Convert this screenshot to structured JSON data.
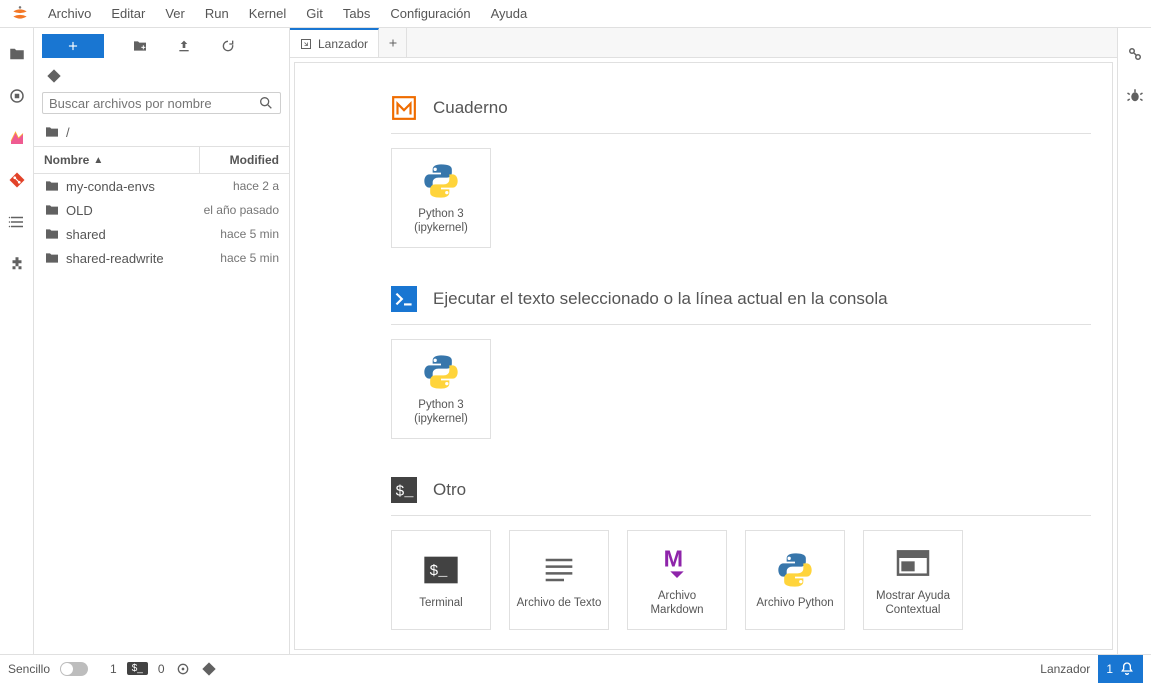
{
  "menubar": [
    "Archivo",
    "Editar",
    "Ver",
    "Run",
    "Kernel",
    "Git",
    "Tabs",
    "Configuración",
    "Ayuda"
  ],
  "file_panel": {
    "search_placeholder": "Buscar archivos por nombre",
    "breadcrumb": "/",
    "header_name": "Nombre",
    "header_modified": "Modified",
    "files": [
      {
        "name": "my-conda-envs",
        "modified": "hace 2 a"
      },
      {
        "name": "OLD",
        "modified": "el año pasado"
      },
      {
        "name": "shared",
        "modified": "hace 5 min"
      },
      {
        "name": "shared-readwrite",
        "modified": "hace 5 min"
      }
    ]
  },
  "tab": {
    "title": "Lanzador"
  },
  "launcher": {
    "sections": {
      "notebook": {
        "title": "Cuaderno",
        "kernel_label": "Python 3\n(ipykernel)"
      },
      "console": {
        "title": "Ejecutar el texto seleccionado o la línea actual en la consola",
        "kernel_label": "Python 3\n(ipykernel)"
      },
      "other": {
        "title": "Otro",
        "items": [
          "Terminal",
          "Archivo de Texto",
          "Archivo Markdown",
          "Archivo Python",
          "Mostrar Ayuda Contextual"
        ]
      }
    }
  },
  "status": {
    "simple": "Sencillo",
    "term_count": "1",
    "kernel_count": "0",
    "right_label": "Lanzador",
    "bell_count": "1"
  }
}
